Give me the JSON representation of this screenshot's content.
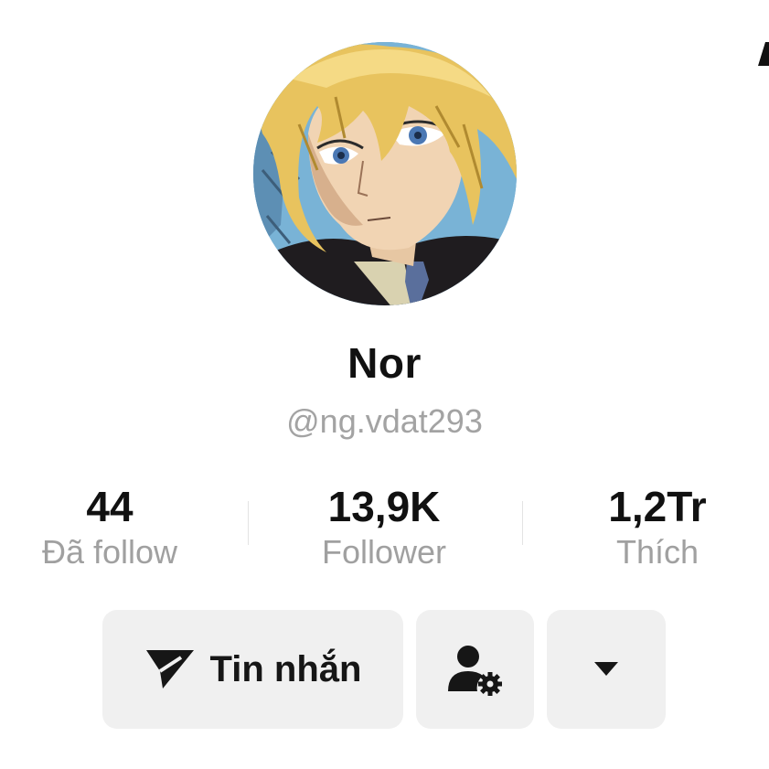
{
  "profile": {
    "display_name": "Nor",
    "username": "@ng.vdat293",
    "avatar_icon": "anime-avatar-image"
  },
  "stats": [
    {
      "value": "44",
      "label": "Đã follow"
    },
    {
      "value": "13,9K",
      "label": "Follower"
    },
    {
      "value": "1,2Tr",
      "label": "Thích"
    }
  ],
  "actions": {
    "message_label": "Tin nhắn",
    "message_icon": "send-icon",
    "profile_icon": "user-settings-icon",
    "more_icon": "caret-down-icon"
  },
  "colors": {
    "text_primary": "#111111",
    "text_secondary": "#a0a0a0",
    "button_bg": "#f0f0f0"
  }
}
